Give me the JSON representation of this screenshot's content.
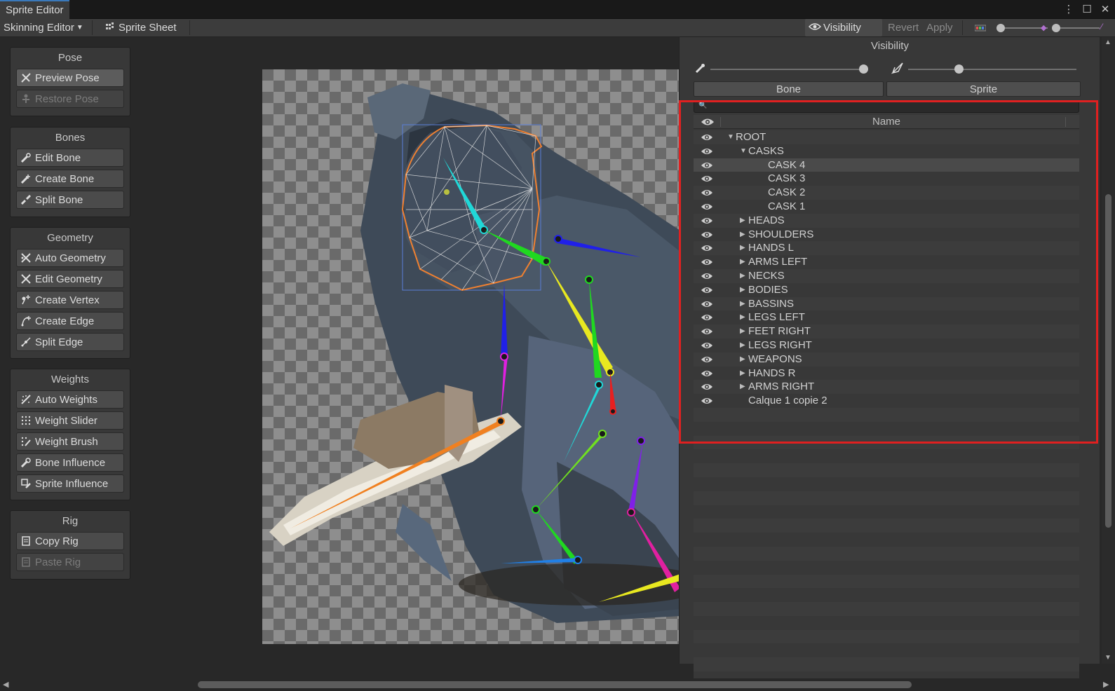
{
  "window": {
    "tab_title": "Sprite Editor",
    "controls": [
      "⋮",
      "☐",
      "✕"
    ]
  },
  "toolbar": {
    "mode_dropdown": "Skinning Editor",
    "sprite_sheet": "Sprite Sheet",
    "visibility": "Visibility",
    "revert": "Revert",
    "apply": "Apply"
  },
  "panels": {
    "pose": {
      "title": "Pose",
      "buttons": [
        {
          "label": "Preview Pose",
          "icon": "preview-pose-icon",
          "state": "active"
        },
        {
          "label": "Restore Pose",
          "icon": "restore-pose-icon",
          "state": "disabled"
        }
      ]
    },
    "bones": {
      "title": "Bones",
      "buttons": [
        {
          "label": "Edit Bone",
          "icon": "edit-bone-icon"
        },
        {
          "label": "Create Bone",
          "icon": "create-bone-icon"
        },
        {
          "label": "Split Bone",
          "icon": "split-bone-icon"
        }
      ]
    },
    "geometry": {
      "title": "Geometry",
      "buttons": [
        {
          "label": "Auto Geometry",
          "icon": "auto-geometry-icon"
        },
        {
          "label": "Edit Geometry",
          "icon": "edit-geometry-icon"
        },
        {
          "label": "Create Vertex",
          "icon": "create-vertex-icon"
        },
        {
          "label": "Create Edge",
          "icon": "create-edge-icon"
        },
        {
          "label": "Split Edge",
          "icon": "split-edge-icon"
        }
      ]
    },
    "weights": {
      "title": "Weights",
      "buttons": [
        {
          "label": "Auto Weights",
          "icon": "auto-weights-icon"
        },
        {
          "label": "Weight Slider",
          "icon": "weight-slider-icon"
        },
        {
          "label": "Weight Brush",
          "icon": "weight-brush-icon"
        },
        {
          "label": "Bone Influence",
          "icon": "bone-influence-icon"
        },
        {
          "label": "Sprite Influence",
          "icon": "sprite-influence-icon"
        }
      ]
    },
    "rig": {
      "title": "Rig",
      "buttons": [
        {
          "label": "Copy Rig",
          "icon": "copy-rig-icon"
        },
        {
          "label": "Paste Rig",
          "icon": "paste-rig-icon",
          "state": "disabled"
        }
      ]
    }
  },
  "visibility_panel": {
    "title": "Visibility",
    "bone_opacity": 1.0,
    "mesh_opacity": 0.3,
    "tabs": [
      "Bone",
      "Sprite"
    ],
    "search_placeholder": "",
    "column_name": "Name",
    "rows": [
      {
        "label": "ROOT",
        "depth": 0,
        "arrow": "▼"
      },
      {
        "label": "CASKS",
        "depth": 1,
        "arrow": "▼"
      },
      {
        "label": "CASK 4",
        "depth": 2,
        "arrow": "",
        "selected": true
      },
      {
        "label": "CASK 3",
        "depth": 2,
        "arrow": ""
      },
      {
        "label": "CASK 2",
        "depth": 2,
        "arrow": ""
      },
      {
        "label": "CASK 1",
        "depth": 2,
        "arrow": ""
      },
      {
        "label": "HEADS",
        "depth": 1,
        "arrow": "▶"
      },
      {
        "label": "SHOULDERS",
        "depth": 1,
        "arrow": "▶"
      },
      {
        "label": "HANDS L",
        "depth": 1,
        "arrow": "▶"
      },
      {
        "label": "ARMS LEFT",
        "depth": 1,
        "arrow": "▶"
      },
      {
        "label": "NECKS",
        "depth": 1,
        "arrow": "▶"
      },
      {
        "label": "BODIES",
        "depth": 1,
        "arrow": "▶"
      },
      {
        "label": "BASSINS",
        "depth": 1,
        "arrow": "▶"
      },
      {
        "label": "LEGS LEFT",
        "depth": 1,
        "arrow": "▶"
      },
      {
        "label": "FEET RIGHT",
        "depth": 1,
        "arrow": "▶"
      },
      {
        "label": "LEGS RIGHT",
        "depth": 1,
        "arrow": "▶"
      },
      {
        "label": "WEAPONS",
        "depth": 1,
        "arrow": "▶"
      },
      {
        "label": "HANDS R",
        "depth": 1,
        "arrow": "▶"
      },
      {
        "label": "ARMS RIGHT",
        "depth": 1,
        "arrow": "▶"
      },
      {
        "label": "Calque 1 copie 2",
        "depth": 1,
        "arrow": "",
        "no_arrow_indent": true
      }
    ]
  },
  "colors": {
    "accent": "#3a79bb",
    "highlight_box": "#e02020"
  }
}
